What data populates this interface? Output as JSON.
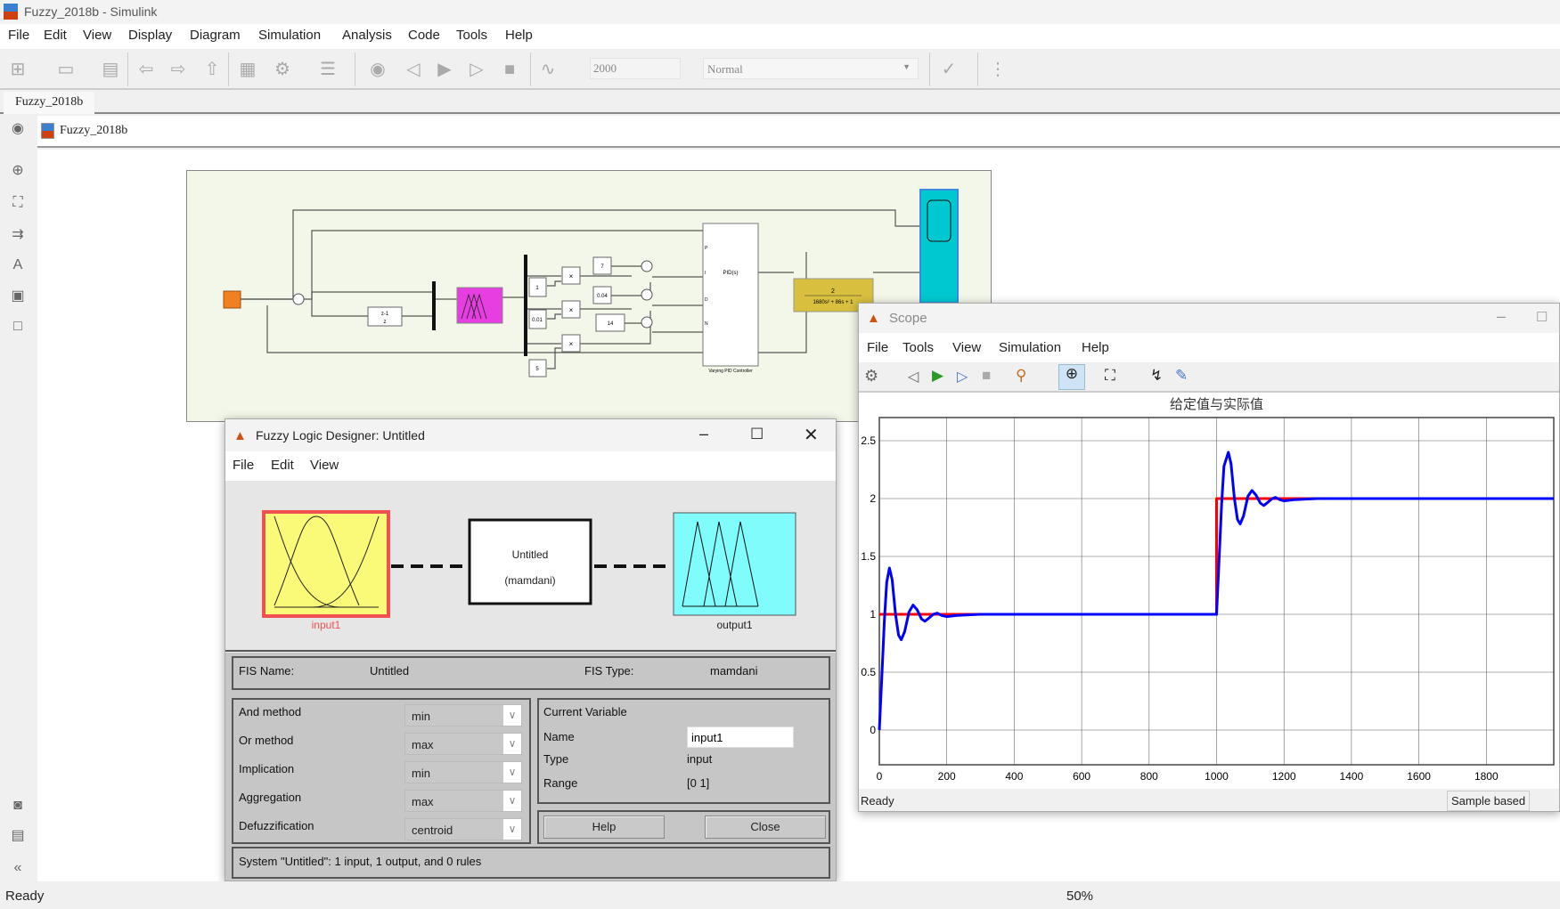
{
  "app": {
    "title": "Fuzzy_2018b - Simulink",
    "tab": "Fuzzy_2018b",
    "breadcrumb": "Fuzzy_2018b",
    "menu": [
      "File",
      "Edit",
      "View",
      "Display",
      "Diagram",
      "Simulation",
      "Analysis",
      "Code",
      "Tools",
      "Help"
    ],
    "stop_time": "2000",
    "sim_mode": "Normal",
    "status": "Ready",
    "zoom": "50%"
  },
  "diagram": {
    "blocks": {
      "delay_num": "z-1",
      "delay_den": "z",
      "const1": "1",
      "const2": "0.01",
      "const3": "5",
      "const_p": "7",
      "const_i": "0.04",
      "const_d": "14",
      "product": "×",
      "pid": "PID(s)",
      "pid_label": "Varying PID Controller",
      "pid_ports": [
        "P",
        "I",
        "D",
        "N"
      ],
      "tf_num": "2",
      "tf_den": "1680s² + 86s + 1"
    },
    "colors": {
      "background": "#f2f7e9",
      "step": "#f08020",
      "fuzzy": "#e63ee0",
      "tf": "#d8bf3e",
      "scope": "#00c8d0"
    }
  },
  "fuzzy": {
    "title": "Fuzzy Logic Designer: Untitled",
    "menu": [
      "File",
      "Edit",
      "View"
    ],
    "input_label": "input1",
    "output_label": "output1",
    "system_name": "Untitled",
    "system_type": "(mamdani)",
    "fis_name_label": "FIS Name:",
    "fis_name": "Untitled",
    "fis_type_label": "FIS Type:",
    "fis_type": "mamdani",
    "methods": [
      {
        "label": "And method",
        "value": "min"
      },
      {
        "label": "Or method",
        "value": "max"
      },
      {
        "label": "Implication",
        "value": "min"
      },
      {
        "label": "Aggregation",
        "value": "max"
      },
      {
        "label": "Defuzzification",
        "value": "centroid"
      }
    ],
    "current_variable": {
      "heading": "Current Variable",
      "name_label": "Name",
      "name_value": "input1",
      "type_label": "Type",
      "type_value": "input",
      "range_label": "Range",
      "range_value": "[0 1]"
    },
    "help": "Help",
    "close": "Close",
    "status": "System \"Untitled\": 1 input, 1 output, and 0 rules"
  },
  "scope": {
    "title": "Scope",
    "menu": [
      "File",
      "Tools",
      "View",
      "Simulation",
      "Help"
    ],
    "status": "Ready",
    "sample": "Sample based"
  },
  "chart_data": {
    "type": "line",
    "title": "给定值与实际值",
    "xlim": [
      0,
      2000
    ],
    "ylim": [
      -0.3,
      2.7
    ],
    "grid": true,
    "xticks": [
      0,
      200,
      400,
      600,
      800,
      1000,
      1200,
      1400,
      1600,
      1800
    ],
    "yticks": [
      0,
      0.5,
      1,
      1.5,
      2,
      2.5
    ],
    "series": [
      {
        "color": "#ff0000",
        "points": [
          [
            0,
            1
          ],
          [
            1000,
            1
          ],
          [
            1000,
            2
          ],
          [
            2000,
            2
          ]
        ]
      },
      {
        "color": "#0000ff",
        "points": [
          [
            0,
            0
          ],
          [
            8,
            0.5
          ],
          [
            15,
            0.95
          ],
          [
            22,
            1.28
          ],
          [
            30,
            1.4
          ],
          [
            38,
            1.3
          ],
          [
            48,
            1.0
          ],
          [
            57,
            0.82
          ],
          [
            65,
            0.78
          ],
          [
            75,
            0.85
          ],
          [
            88,
            1.02
          ],
          [
            100,
            1.08
          ],
          [
            112,
            1.04
          ],
          [
            125,
            0.96
          ],
          [
            135,
            0.94
          ],
          [
            148,
            0.97
          ],
          [
            160,
            1.0
          ],
          [
            172,
            1.01
          ],
          [
            185,
            0.99
          ],
          [
            200,
            0.98
          ],
          [
            230,
            0.99
          ],
          [
            300,
            1.0
          ],
          [
            1000,
            1.0
          ],
          [
            1008,
            1.5
          ],
          [
            1015,
            1.95
          ],
          [
            1022,
            2.28
          ],
          [
            1035,
            2.4
          ],
          [
            1043,
            2.3
          ],
          [
            1053,
            2.0
          ],
          [
            1062,
            1.82
          ],
          [
            1070,
            1.78
          ],
          [
            1080,
            1.85
          ],
          [
            1093,
            2.02
          ],
          [
            1105,
            2.07
          ],
          [
            1117,
            2.03
          ],
          [
            1130,
            1.96
          ],
          [
            1140,
            1.94
          ],
          [
            1153,
            1.97
          ],
          [
            1165,
            2.0
          ],
          [
            1175,
            2.01
          ],
          [
            1188,
            1.99
          ],
          [
            1200,
            1.98
          ],
          [
            1230,
            1.99
          ],
          [
            1300,
            2.0
          ],
          [
            2000,
            2.0
          ]
        ]
      }
    ]
  }
}
